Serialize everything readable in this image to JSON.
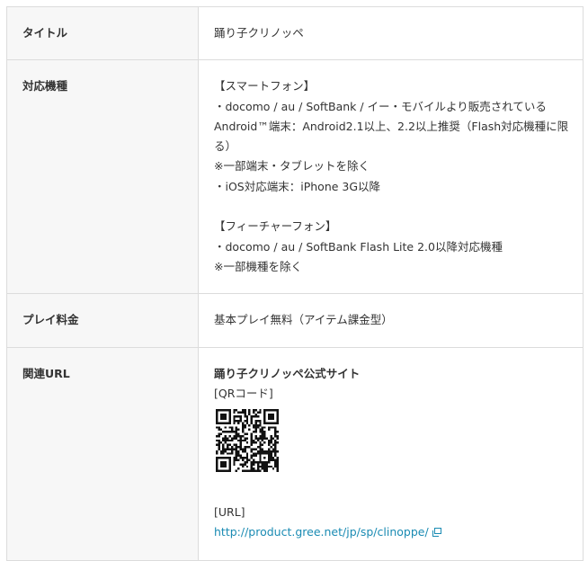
{
  "rows": {
    "title": {
      "label": "タイトル",
      "value": "踊り子クリノッペ"
    },
    "compatible": {
      "label": "対応機種",
      "lines": [
        "【スマートフォン】",
        "・docomo / au / SoftBank / イー・モバイルより販売されている",
        "Android™端末：Android2.1以上、2.2以上推奨（Flash対応機種に限",
        "る）",
        "※一部端末・タブレットを除く",
        "・iOS対応端末：iPhone 3G以降",
        "【フィーチャーフォン】",
        "・docomo / au / SoftBank Flash Lite 2.0以降対応機種",
        "※一部機種を除く"
      ]
    },
    "price": {
      "label": "プレイ料金",
      "value": "基本プレイ無料（アイテム課金型）"
    },
    "url": {
      "label": "関連URL",
      "site_name": "踊り子クリノッペ公式サイト",
      "qr_label": "[QRコード]",
      "url_label": "[URL]",
      "url": "http://product.gree.net/jp/sp/clinoppe/"
    }
  },
  "icons": {
    "external_link": "external-link-icon",
    "qr": "qr-code-icon"
  },
  "colors": {
    "header_bg": "#f7f7f7",
    "border": "#dcdcdc",
    "text": "#333333",
    "link": "#1a8bb3"
  }
}
